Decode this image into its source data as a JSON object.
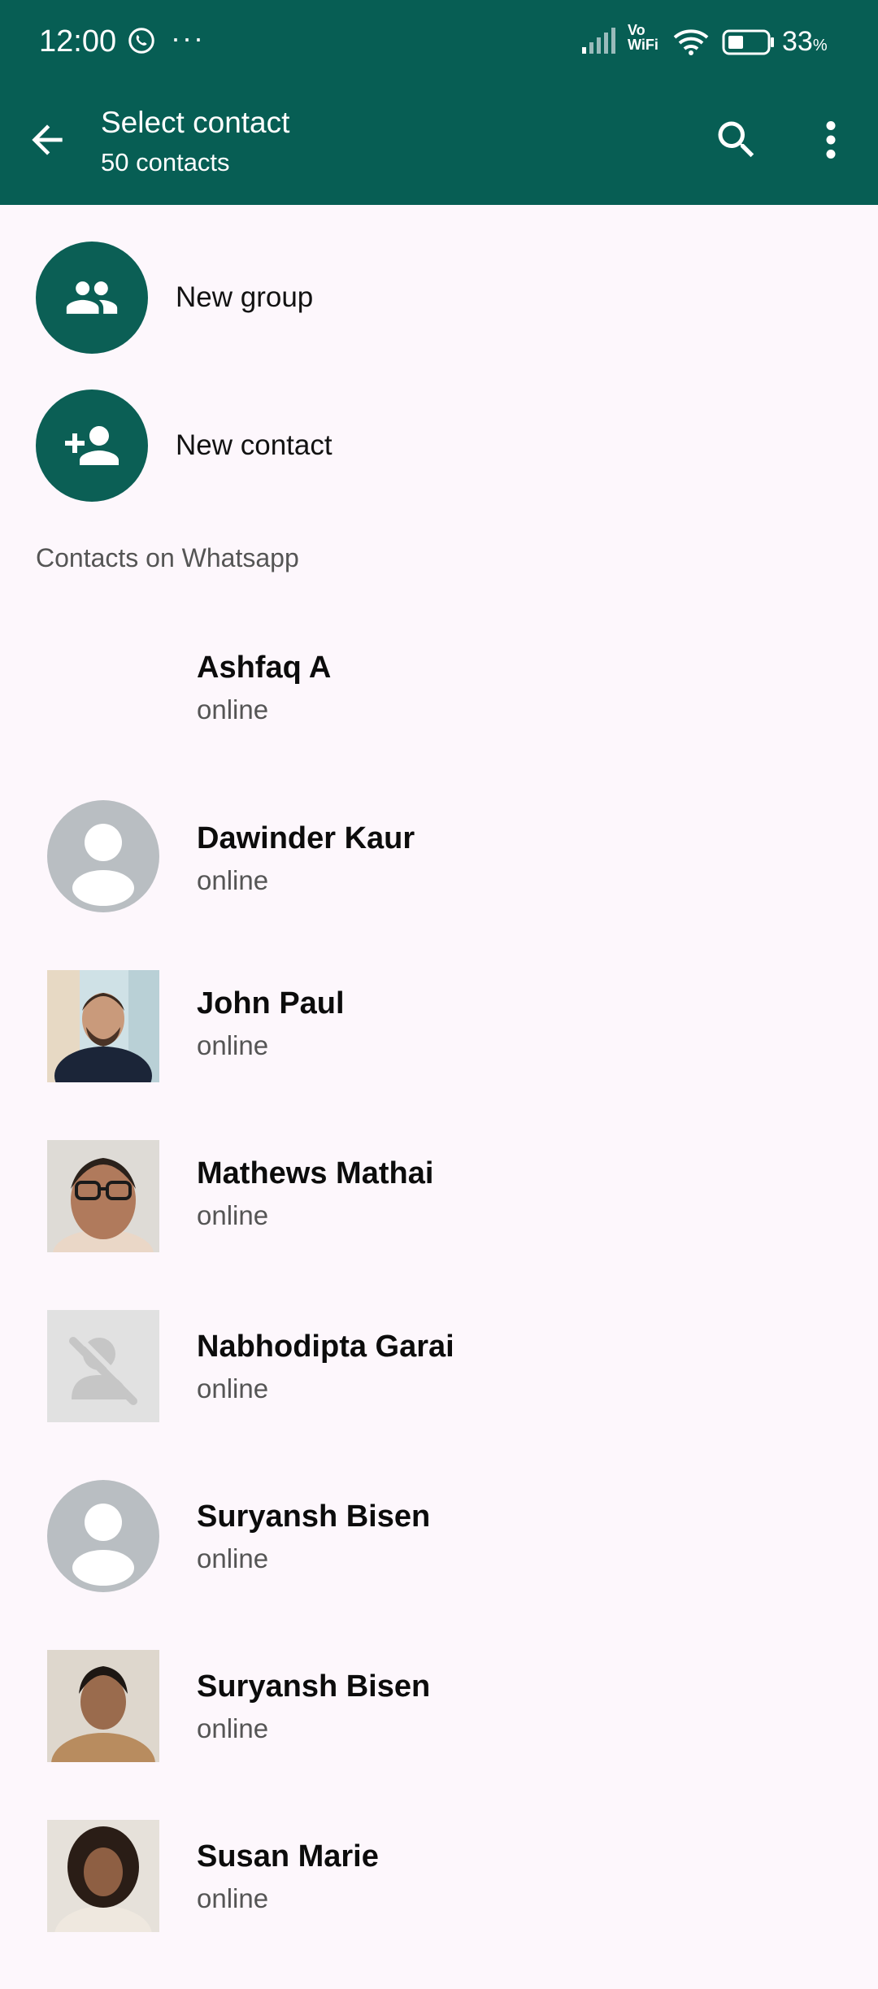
{
  "status_bar": {
    "time": "12:00",
    "dots": "···",
    "vowifi_top": "Vo",
    "vowifi_bottom": "WiFi",
    "battery_percent": "33",
    "battery_unit": "%"
  },
  "toolbar": {
    "title": "Select contact",
    "subtitle": "50 contacts"
  },
  "actions": [
    {
      "label": "New group",
      "icon": "group-icon"
    },
    {
      "label": "New contact",
      "icon": "add-person-icon"
    }
  ],
  "section_header": "Contacts on Whatsapp",
  "contacts": [
    {
      "name": "Ashfaq A",
      "status": "online",
      "avatar": "none"
    },
    {
      "name": "Dawinder Kaur",
      "status": "online",
      "avatar": "default-round"
    },
    {
      "name": "John Paul",
      "status": "online",
      "avatar": "photo"
    },
    {
      "name": "Mathews Mathai",
      "status": "online",
      "avatar": "photo"
    },
    {
      "name": "Nabhodipta Garai",
      "status": "online",
      "avatar": "hidden-photo"
    },
    {
      "name": "Suryansh Bisen",
      "status": "online",
      "avatar": "default-round"
    },
    {
      "name": "Suryansh Bisen",
      "status": "online",
      "avatar": "photo"
    },
    {
      "name": "Susan Marie",
      "status": "online",
      "avatar": "photo"
    }
  ],
  "colors": {
    "app_bar": "#075e54",
    "accent_circle": "#0b5f55",
    "background": "#fdf7fc"
  }
}
